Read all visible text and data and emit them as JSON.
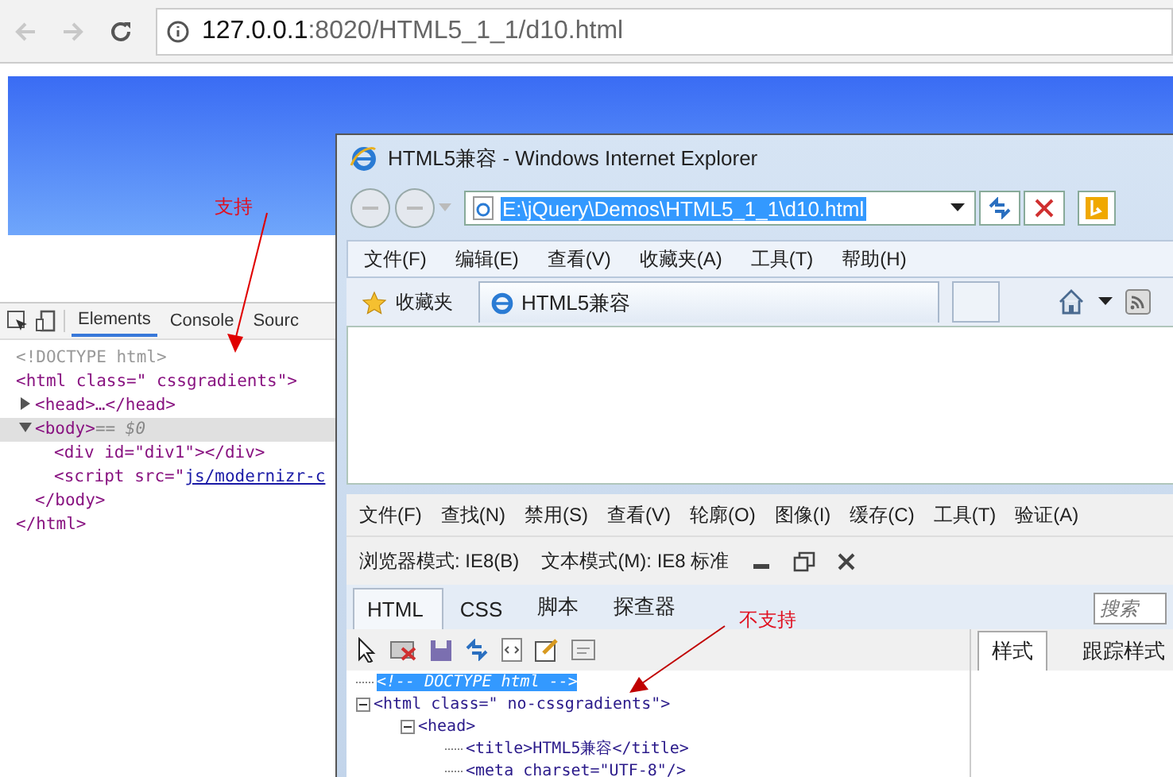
{
  "chrome": {
    "url_host": "127.0.0.1",
    "url_path": ":8020/HTML5_1_1/d10.html",
    "devtools": {
      "tabs": [
        {
          "label": "Elements",
          "selected": true
        },
        {
          "label": "Console",
          "selected": false
        },
        {
          "label": "Sourc",
          "selected": false
        }
      ],
      "dom": [
        {
          "text": "<!DOCTYPE html>",
          "kind": "doctype"
        },
        {
          "text": "<html class=\" cssgradients\">",
          "kind": "element",
          "end": "</html>",
          "children": [
            {
              "text": "<head>…</head>",
              "kind": "element",
              "expanded": false,
              "selected": false
            },
            {
              "text": "<body>",
              "suffix": "== $0",
              "kind": "element",
              "expanded": true,
              "selected": true,
              "end": "</body>",
              "children": [
                {
                  "text": "<div id=\"div1\"></div>",
                  "kind": "element"
                },
                {
                  "text": "<script src=\"",
                  "link": "js/modernizr-c",
                  "kind": "element"
                }
              ]
            }
          ]
        }
      ]
    }
  },
  "ie": {
    "title": "HTML5兼容 - Windows Internet Explorer",
    "address": "E:\\jQuery\\Demos\\HTML5_1_1\\d10.html",
    "menu": [
      "文件(F)",
      "编辑(E)",
      "查看(V)",
      "收藏夹(A)",
      "工具(T)",
      "帮助(H)"
    ],
    "favorites": "收藏夹",
    "tab": "HTML5兼容",
    "devtools": {
      "menu": [
        "文件(F)",
        "查找(N)",
        "禁用(S)",
        "查看(V)",
        "轮廓(O)",
        "图像(I)",
        "缓存(C)",
        "工具(T)",
        "验证(A)"
      ],
      "browser_mode": "浏览器模式: IE8(B)",
      "document_mode": "文本模式(M):  IE8 标准",
      "tabs": [
        {
          "label": "HTML",
          "selected": true
        },
        {
          "label": "CSS",
          "selected": false
        },
        {
          "label": "脚本",
          "selected": false
        },
        {
          "label": "探查器",
          "selected": false
        }
      ],
      "search": {
        "placeholder": "搜索"
      },
      "side_tabs": [
        {
          "label": "样式",
          "selected": true
        },
        {
          "label": "跟踪样式",
          "selected": false
        }
      ],
      "dom": [
        {
          "text": "<!-- DOCTYPE html -->",
          "kind": "comment",
          "selected": true
        },
        {
          "text": "<html class=\" no-cssgradients\">",
          "kind": "element",
          "expanded": true,
          "selected": false,
          "children": [
            {
              "text": "<head>",
              "kind": "element",
              "expanded": true,
              "selected": false,
              "children": [
                {
                  "text": "<title>HTML5兼容</title>",
                  "kind": "element",
                  "selected": false
                },
                {
                  "text": "<meta charset=\"UTF-8\"/>",
                  "kind": "element",
                  "selected": false
                }
              ]
            }
          ]
        }
      ]
    }
  },
  "annotations": [
    {
      "text": "支持"
    },
    {
      "text": "不支持"
    }
  ]
}
